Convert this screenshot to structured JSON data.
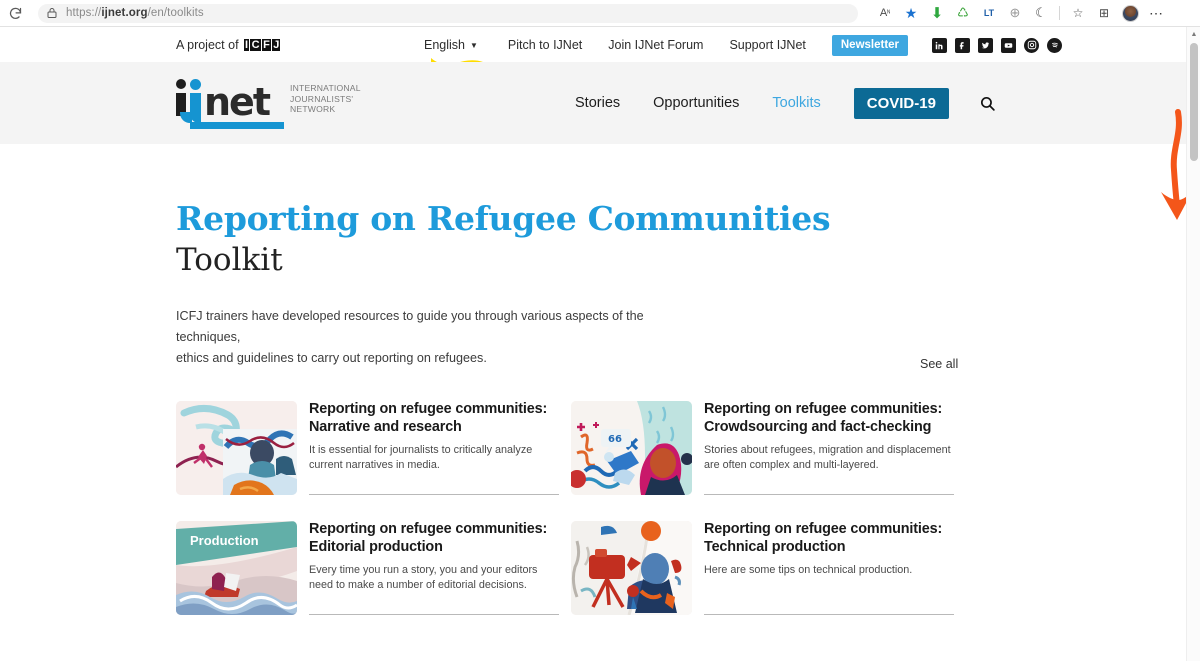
{
  "browser": {
    "url_prefix": "https://",
    "url_domain": "ijnet.org",
    "url_path": "/en/toolkits",
    "url_full": "https://ijnet.org/en/toolkits",
    "reload_icon": "reload-icon",
    "lock_icon": "lock-icon",
    "toolbar_icons": [
      {
        "name": "read-aloud-icon",
        "glyph": "Aᴺ"
      },
      {
        "name": "favorite-star-icon",
        "glyph": "★",
        "color": "#1b72d0"
      },
      {
        "name": "download-icon",
        "glyph": "⬇",
        "color": "#2fa83f"
      },
      {
        "name": "recycle-extension-icon",
        "glyph": "♻",
        "color": "#3aa33a"
      },
      {
        "name": "languagetool-icon",
        "glyph": "LT",
        "color": "#1f5fa8"
      },
      {
        "name": "globe-extension-icon",
        "glyph": "⊕",
        "color": "#9a9a9a"
      },
      {
        "name": "copilot-icon",
        "glyph": "◔",
        "color": "#4b4b4b"
      },
      {
        "name": "collections-icon",
        "glyph": "✦",
        "color": "#4b4b4b"
      },
      {
        "name": "browser-essentials-icon",
        "glyph": "⬡",
        "color": "#4b4b4b"
      },
      {
        "name": "profile-avatar",
        "glyph": ""
      },
      {
        "name": "settings-more-icon",
        "glyph": "⋯",
        "color": "#3b3b3b"
      }
    ]
  },
  "utility_bar": {
    "project_of_label": "A project of",
    "icfj_logo": "ICFJ",
    "language": {
      "label": "English",
      "caret": "▾"
    },
    "links": [
      "Pitch to IJNet",
      "Join IJNet Forum",
      "Support IJNet"
    ],
    "newsletter_label": "Newsletter",
    "newsletter_color": "#3ea7e0",
    "socials": [
      "linkedin-icon",
      "facebook-icon",
      "twitter-icon",
      "youtube-icon",
      "instagram-icon",
      "spotify-icon"
    ]
  },
  "header": {
    "logo": {
      "ij": "ij",
      "net": "net",
      "subtitle_line1": "INTERNATIONAL",
      "subtitle_line2": "JOURNALISTS'",
      "subtitle_line3": "NETWORK",
      "brand_blue": "#1594d1"
    },
    "nav": [
      {
        "label": "Stories",
        "active": false
      },
      {
        "label": "Opportunities",
        "active": false
      },
      {
        "label": "Toolkits",
        "active": true
      }
    ],
    "covid_label": "COVID-19",
    "covid_color": "#0c6a95",
    "search_icon": "search-icon"
  },
  "page": {
    "title": "Reporting on Refugee Communities",
    "subtitle": "Toolkit",
    "title_color": "#1e9bdb",
    "description_line1": "ICFJ trainers have developed resources to guide you through various aspects of the techniques,",
    "description_line2": "ethics and guidelines to carry out reporting on refugees.",
    "see_all_label": "See all"
  },
  "cards": [
    {
      "title": "Reporting on refugee communities: Narrative and research",
      "description": "It is essential for journalists to critically analyze current narratives in media.",
      "thumb_name": "thumbnail-narrative-research"
    },
    {
      "title": "Reporting on refugee communities: Crowdsourcing and fact-checking",
      "description": "Stories about refugees, migration and displacement are often complex and multi-layered.",
      "thumb_name": "thumbnail-crowdsourcing-factchecking"
    },
    {
      "title": "Reporting on refugee communities: Editorial production",
      "description": "Every time you run a story, you and your editors need to make a number of editorial decisions.",
      "thumb_name": "thumbnail-editorial-production",
      "thumb_overlay_text": "Production"
    },
    {
      "title": "Reporting on refugee communities: Technical production",
      "description": "Here are some tips on technical production.",
      "thumb_name": "thumbnail-technical-production"
    }
  ],
  "annotations": {
    "highlight_color": "#ffdd00",
    "arrow_color": "#f4561a"
  }
}
